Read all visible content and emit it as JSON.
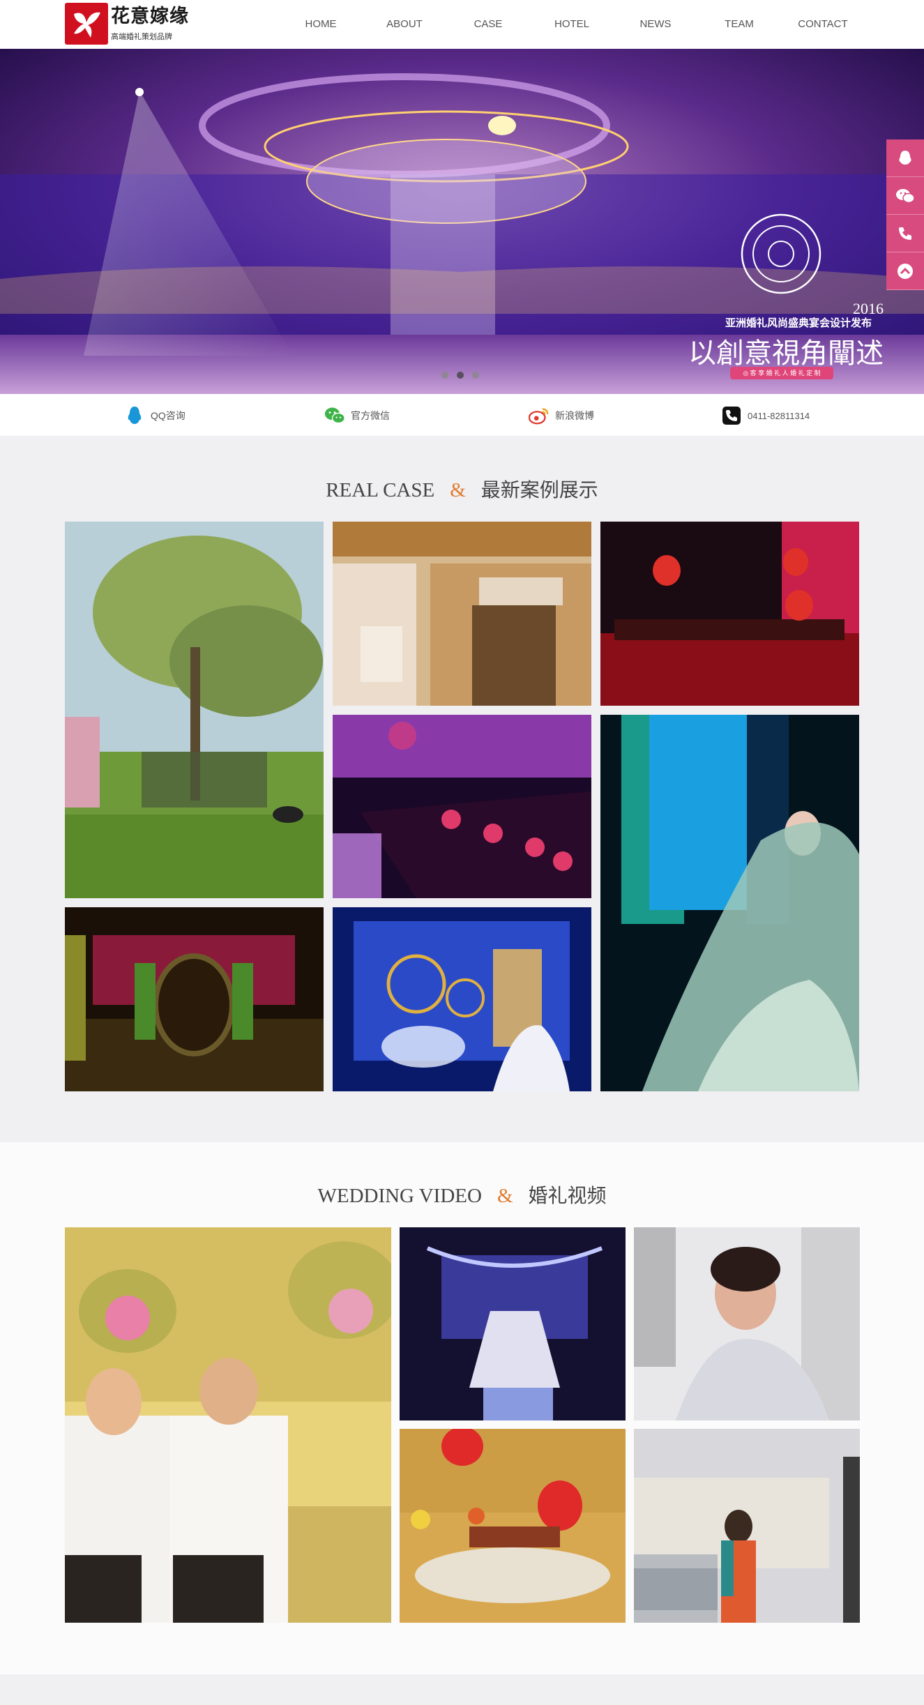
{
  "header": {
    "logo_cn": "花意嫁缘",
    "logo_sub": "高端婚礼策划品牌",
    "nav": [
      "HOME",
      "ABOUT",
      "CASE",
      "HOTEL",
      "NEWS",
      "TEAM",
      "CONTACT"
    ]
  },
  "banner": {
    "year": "2016",
    "subtitle": "亚洲婚礼风尚盛典宴会设计发布",
    "headline": "以創意視角闡述",
    "tag": "◎ 客 享 婚 礼 人 婚 礼 定 制",
    "slide_dots": 3,
    "active_dot": 2
  },
  "side_tools": [
    "qq-icon",
    "wechat-icon",
    "phone-icon",
    "back-to-top-icon"
  ],
  "contacts": [
    {
      "label": "QQ咨询",
      "icon": "qq-icon"
    },
    {
      "label": "官方微信",
      "icon": "wechat-icon"
    },
    {
      "label": "新浪微博",
      "icon": "weibo-icon"
    },
    {
      "label": "0411-82811314",
      "icon": "phone-icon"
    }
  ],
  "real_case": {
    "en": "REAL CASE",
    "amp": "&",
    "cn": "最新案例展示"
  },
  "wedding_video": {
    "en": "WEDDING VIDEO",
    "amp": "&",
    "cn": "婚礼视频"
  },
  "colors": {
    "brand_red": "#d0101f",
    "accent_orange": "#e07b2c",
    "side_pink": "#d84b7e",
    "section_gray": "#f0eff2"
  }
}
